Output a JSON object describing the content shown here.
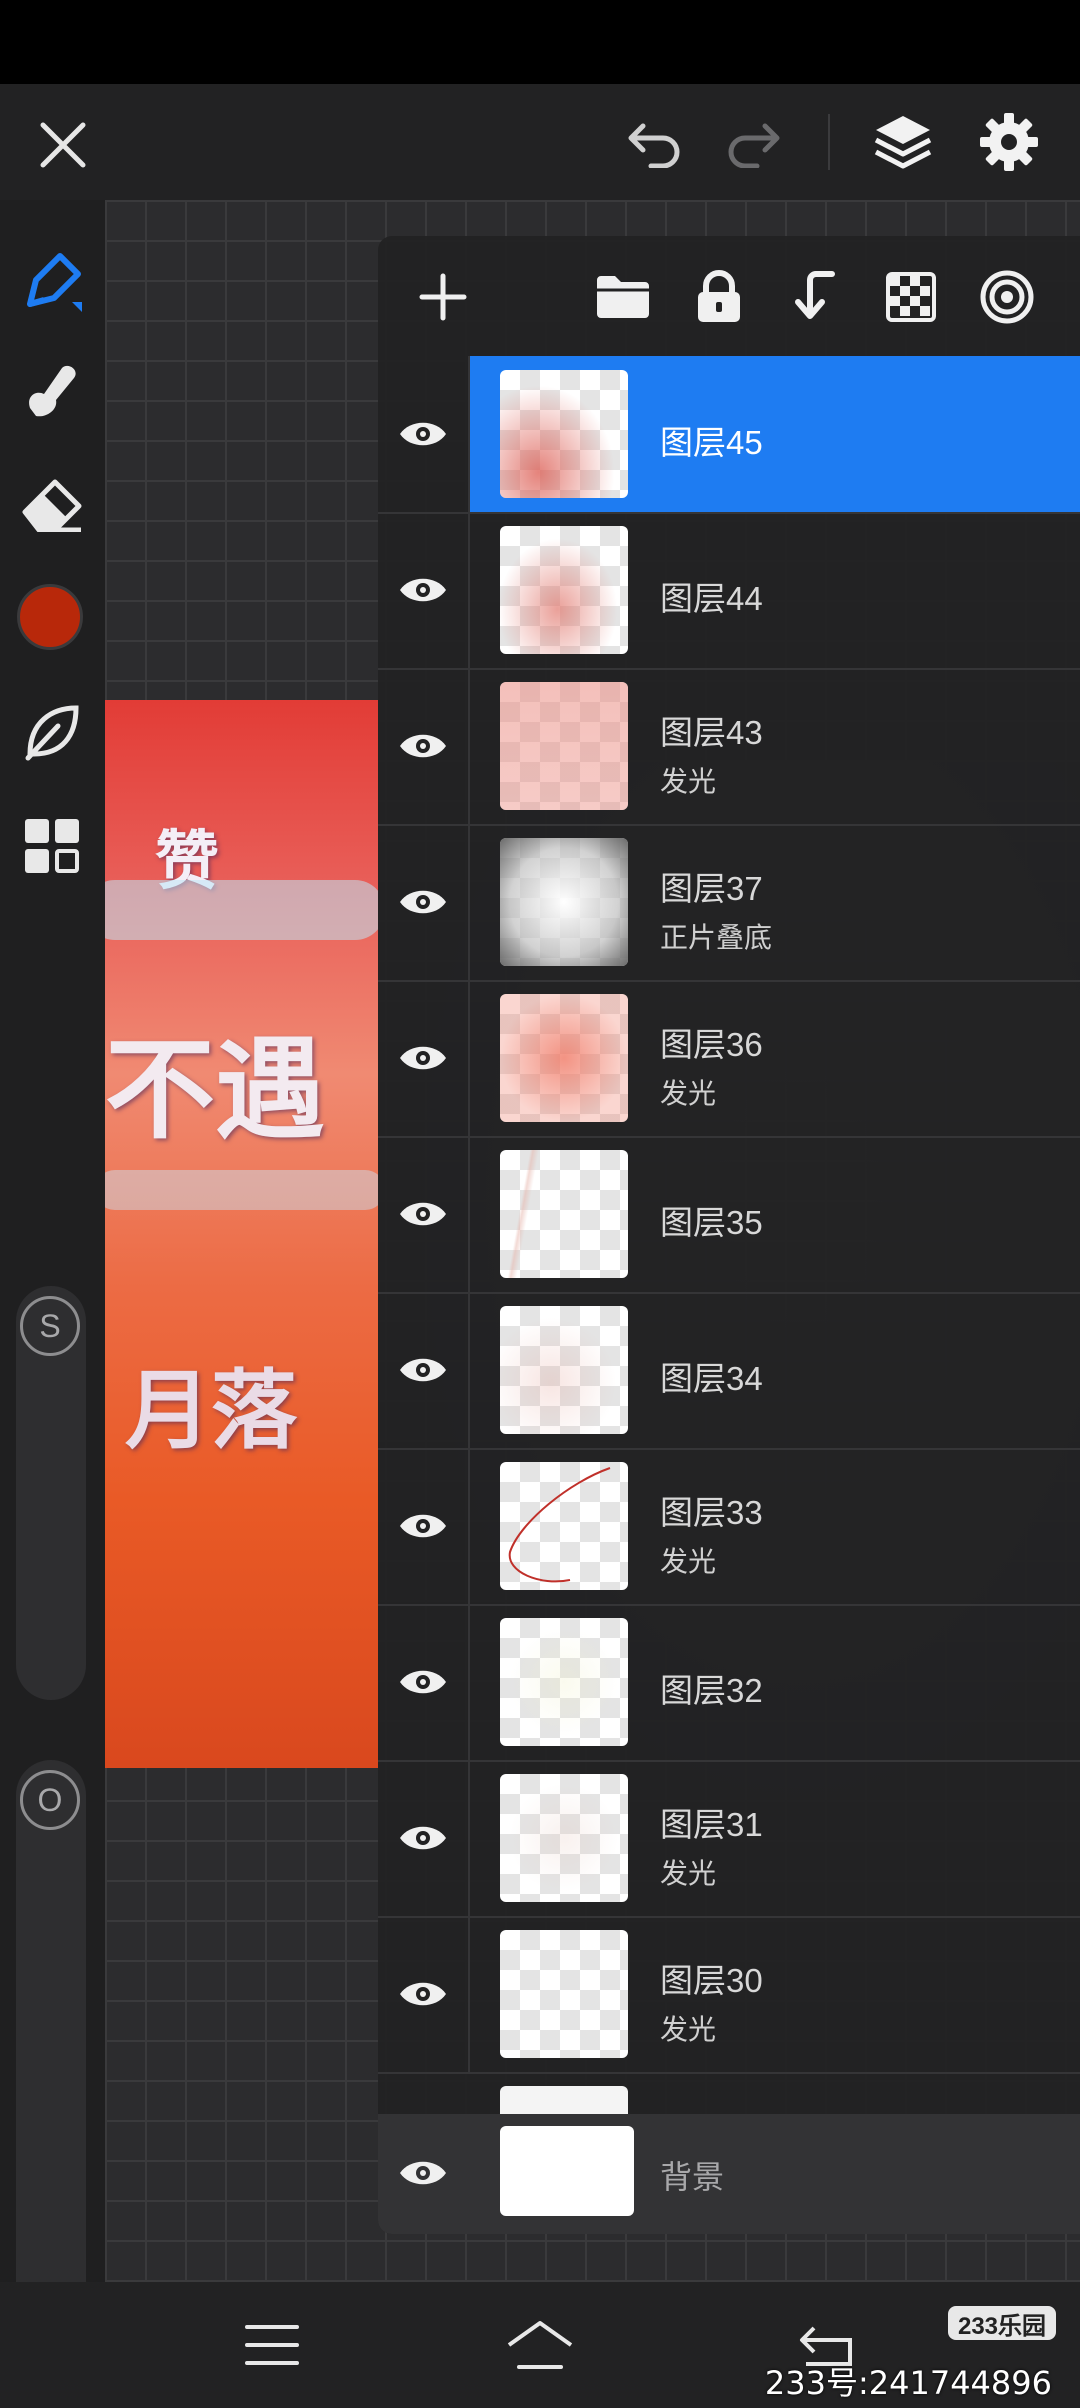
{
  "colors": {
    "accent": "#1e7cf2",
    "brush_color": "#b8280a",
    "panel_bg": "#222223"
  },
  "toolbar": {
    "close": "close-icon",
    "undo": "undo-icon",
    "redo": "redo-icon",
    "layers": "layers-icon",
    "settings": "gear-icon"
  },
  "left_tools": [
    "brush-icon",
    "smudge-icon",
    "eraser-icon",
    "color-swatch",
    "leaf-icon",
    "grid-icon"
  ],
  "sliders": {
    "size_label": "S",
    "opacity_label": "O"
  },
  "artwork": {
    "line1": "赞",
    "line2": "不遇",
    "line3": "月落"
  },
  "layers_panel": {
    "toolbar_icons": [
      "plus-icon",
      "folder-icon",
      "lock-icon",
      "merge-down-icon",
      "checker-icon",
      "target-icon"
    ],
    "layers": [
      {
        "name": "图层45",
        "mode": "",
        "selected": true
      },
      {
        "name": "图层44",
        "mode": ""
      },
      {
        "name": "图层43",
        "mode": "发光"
      },
      {
        "name": "图层37",
        "mode": "正片叠底"
      },
      {
        "name": "图层36",
        "mode": "发光"
      },
      {
        "name": "图层35",
        "mode": ""
      },
      {
        "name": "图层34",
        "mode": ""
      },
      {
        "name": "图层33",
        "mode": "发光"
      },
      {
        "name": "图层32",
        "mode": ""
      },
      {
        "name": "图层31",
        "mode": "发光"
      },
      {
        "name": "图层30",
        "mode": "发光"
      }
    ],
    "background": {
      "name": "背景"
    }
  },
  "watermark": {
    "logo": "233乐园",
    "text": "233号:241744896"
  }
}
